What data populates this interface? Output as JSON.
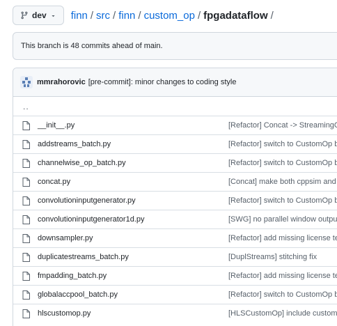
{
  "branch": {
    "name": "dev"
  },
  "breadcrumb": {
    "links": [
      "finn",
      "src",
      "finn",
      "custom_op"
    ],
    "current": "fpgadataflow",
    "separator": "/"
  },
  "ahead_notice": "This branch is 48 commits ahead of main.",
  "latest_commit": {
    "author": "mmrahorovic",
    "message": "[pre-commit]: minor changes to coding style"
  },
  "parent_dir": "..",
  "files": [
    {
      "name": "__init__.py",
      "message": "[Refactor] Concat -> StreamingConcat"
    },
    {
      "name": "addstreams_batch.py",
      "message": "[Refactor] switch to CustomOp base"
    },
    {
      "name": "channelwise_op_batch.py",
      "message": "[Refactor] switch to CustomOp base"
    },
    {
      "name": "concat.py",
      "message": "[Concat] make both cppsim and rtlsim"
    },
    {
      "name": "convolutioninputgenerator.py",
      "message": "[Refactor] switch to CustomOp base"
    },
    {
      "name": "convolutioninputgenerator1d.py",
      "message": "[SWG] no parallel window output w"
    },
    {
      "name": "downsampler.py",
      "message": "[Refactor] add missing license text"
    },
    {
      "name": "duplicatestreams_batch.py",
      "message": "[DuplStreams] stitching fix"
    },
    {
      "name": "fmpadding_batch.py",
      "message": "[Refactor] add missing license text"
    },
    {
      "name": "globalaccpool_batch.py",
      "message": "[Refactor] switch to CustomOp base"
    },
    {
      "name": "hlscustomop.py",
      "message": "[HLSCustomOp] include custom_hls"
    }
  ],
  "colors": {
    "link": "#0969da",
    "muted": "#57606a",
    "border": "#d0d7de",
    "bg_subtle": "#f6f8fa"
  },
  "icons": {
    "branch": "git-branch-icon",
    "caret": "triangle-down-icon",
    "file": "file-icon",
    "avatar": "user-avatar"
  }
}
